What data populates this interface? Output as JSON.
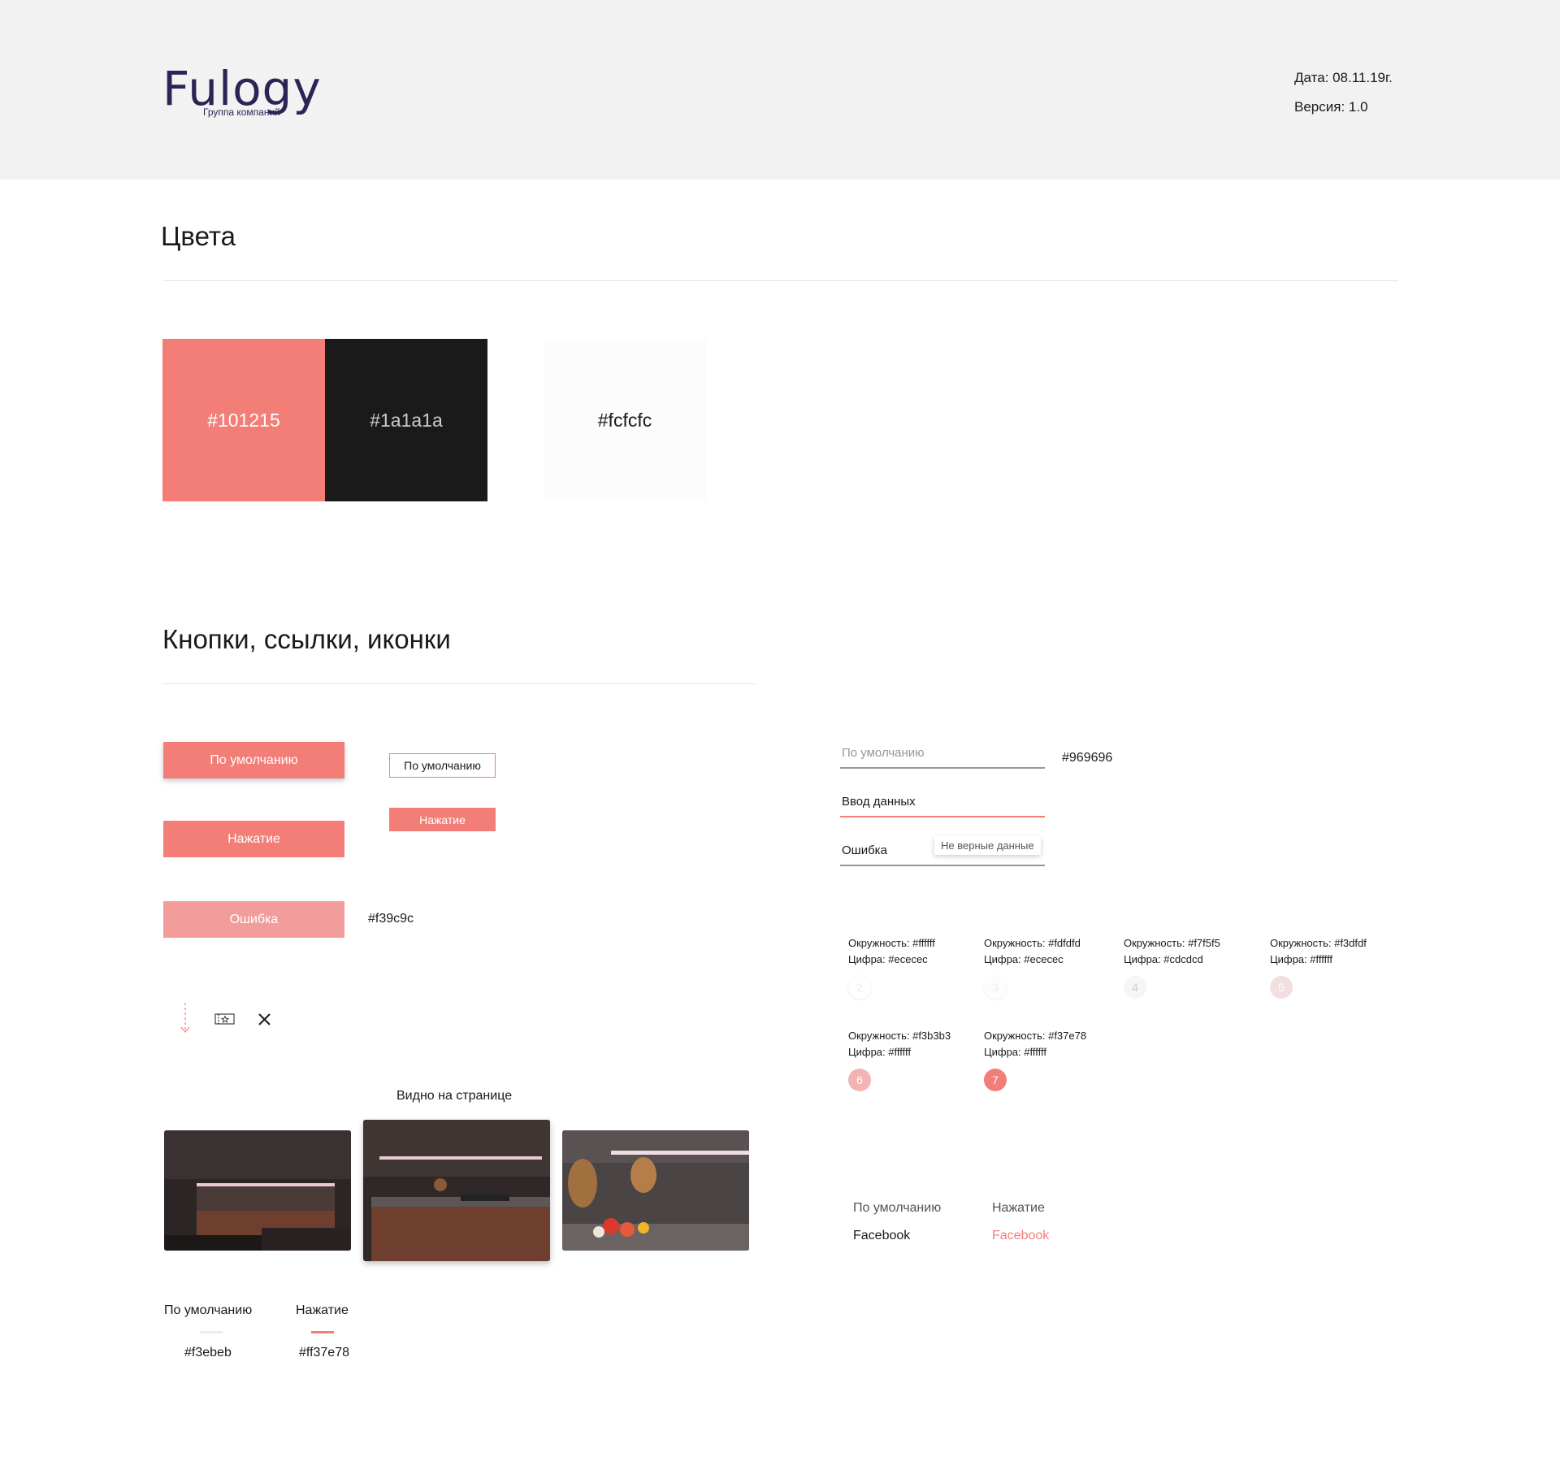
{
  "header": {
    "logo_word": "Fulogy",
    "logo_sub": "Группа компаний",
    "date": "Дата: 08.11.19г.",
    "version": "Версия: 1.0"
  },
  "colors_section": {
    "title": "Цвета",
    "swatches": [
      {
        "label": "#101215",
        "bg": "#f37e78",
        "fg": "#ffffff"
      },
      {
        "label": "#1a1a1a",
        "bg": "#1a1a1a",
        "fg": "#cccccc"
      },
      {
        "label": "#fcfcfc",
        "bg": "#fcfcfc",
        "fg": "#1a1a1a"
      }
    ]
  },
  "buttons_section": {
    "title": "Кнопки, ссылки, иконки",
    "btn_default": "По умолчанию",
    "btn_pressed": "Нажатие",
    "btn_error": "Ошибка",
    "error_color": "#f39c9c",
    "btn_outline": "По умолчанию",
    "btn_small_pressed": "Нажатие"
  },
  "icons": [
    {
      "name": "scroll-down-icon"
    },
    {
      "name": "ticket-icon"
    },
    {
      "name": "close-icon"
    }
  ],
  "inputs": {
    "default_placeholder": "По умолчанию",
    "default_color": "#969696",
    "input_value": "Ввод данных",
    "error_value": "Ошибка",
    "error_tooltip": "Не верные данные"
  },
  "circles": [
    {
      "ring": "Окружность: #ffffff",
      "digit": "Цифра: #ececec",
      "num": "2",
      "bg": "#ffffff",
      "fg": "#ececec"
    },
    {
      "ring": "Окружность: #fdfdfd",
      "digit": "Цифра: #ececec",
      "num": "3",
      "bg": "#fdfdfd",
      "fg": "#ececec"
    },
    {
      "ring": "Окружность: #f7f5f5",
      "digit": "Цифра: #cdcdcd",
      "num": "4",
      "bg": "#f7f5f5",
      "fg": "#cdcdcd"
    },
    {
      "ring": "Окружность: #f3dfdf",
      "digit": "Цифра: #ffffff",
      "num": "5",
      "bg": "#f3dfdf",
      "fg": "#ffffff"
    },
    {
      "ring": "Окружность: #f3b3b3",
      "digit": "Цифра: #ffffff",
      "num": "6",
      "bg": "#f3b3b3",
      "fg": "#ffffff"
    },
    {
      "ring": "Окружность: #f37e78",
      "digit": "Цифра: #ffffff",
      "num": "7",
      "bg": "#f37e78",
      "fg": "#ffffff"
    }
  ],
  "gallery": {
    "caption": "Видно на странице"
  },
  "tabs": {
    "default_label": "По умолчанию",
    "pressed_label": "Нажатие",
    "default_color": "#f3ebeb",
    "pressed_color": "#ff37e78"
  },
  "links": {
    "default_label": "По умолчанию",
    "pressed_label": "Нажатие",
    "default_link": "Facebook",
    "pressed_link": "Facebook"
  }
}
